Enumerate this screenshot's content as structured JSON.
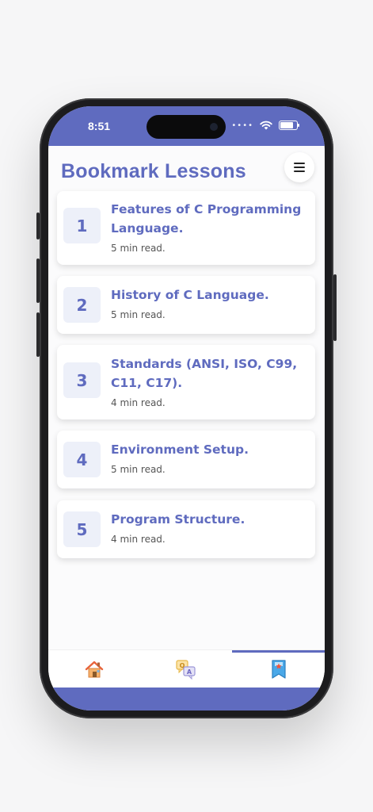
{
  "status_bar": {
    "time": "8:51",
    "signal_dots": "••••"
  },
  "header": {
    "title": "Bookmark Lessons"
  },
  "lessons": [
    {
      "number": "1",
      "title": "Features of C Programming Language.",
      "meta": "5 min read."
    },
    {
      "number": "2",
      "title": "History of C Language.",
      "meta": "5 min read."
    },
    {
      "number": "3",
      "title": "Standards (ANSI, ISO, C99, C11, C17).",
      "meta": "4 min read."
    },
    {
      "number": "4",
      "title": "Environment Setup.",
      "meta": "5 min read."
    },
    {
      "number": "5",
      "title": "Program Structure.",
      "meta": "4 min read."
    }
  ],
  "tabs": [
    {
      "icon": "home-icon",
      "active": false
    },
    {
      "icon": "qa-icon",
      "active": false
    },
    {
      "icon": "bookmark-icon",
      "active": true
    }
  ],
  "colors": {
    "accent": "#5f6bbf",
    "number_bg": "#edf0f9"
  }
}
